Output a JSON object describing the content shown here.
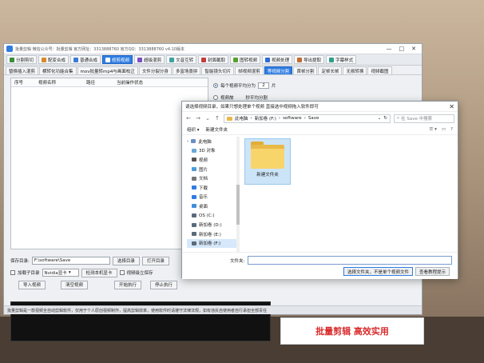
{
  "app": {
    "title": "批量剪辑  微信公众号：批量剪辑  官方网址：3313888760  官方QQ：3313888760  v4.10版本",
    "window_controls": [
      "—",
      "□",
      "✕"
    ]
  },
  "toolbar": {
    "items": [
      {
        "label": "分割剪切",
        "color": "#3a8d3a"
      },
      {
        "label": "配变合成",
        "color": "#d88a2a"
      },
      {
        "label": "普通合成",
        "color": "#3c7ad6"
      },
      {
        "label": "修剪视频",
        "color": "#2f7de1",
        "active": true
      },
      {
        "label": "超级混剪",
        "color": "#7a4fc4"
      },
      {
        "label": "文音互转",
        "color": "#3fa0a0"
      },
      {
        "label": "封面截取",
        "color": "#c43c3c"
      },
      {
        "label": "图转视频",
        "color": "#5a9e2f"
      },
      {
        "label": "视频处理",
        "color": "#2f6ad6"
      },
      {
        "label": "导出提取",
        "color": "#c46a2f"
      },
      {
        "label": "字幕样式",
        "color": "#2f9e8a"
      }
    ]
  },
  "subtabs": {
    "items": [
      {
        "label": "替换插入混剪"
      },
      {
        "label": "横转化功能合集"
      },
      {
        "label": "mov批量转mp4与画面校正"
      },
      {
        "label": "文件分裂分身"
      },
      {
        "label": "多富场景拼"
      },
      {
        "label": "智能镜头切片"
      },
      {
        "label": "帧视频混剪"
      },
      {
        "label": "等视频分割",
        "active": true
      },
      {
        "label": "首帧分割"
      },
      {
        "label": "定帧长帧"
      },
      {
        "label": "无损转换"
      },
      {
        "label": "视频截图"
      }
    ]
  },
  "table": {
    "columns": [
      "序号",
      "视频名称",
      "路径",
      "当前操作状态"
    ]
  },
  "right_panel": {
    "option_split_prefix": "每个视频平均分为",
    "option_split_value": "2",
    "option_split_suffix": "片",
    "option_random": "视频故",
    "option_random_tail": "秒平均分割"
  },
  "controls": {
    "save_dir_label": "保存目录:",
    "save_dir_value": "F:\\software\\Save",
    "choose_dir_btn": "选择目录",
    "open_dir_btn": "打开目录",
    "add_subdir_label": "加载子目录",
    "gpu_select": "Nvidia显卡",
    "detect_gpu_btn": "检测本机显卡",
    "keep_video_label": "视频级立保存",
    "import_btn": "导入视频",
    "clear_btn": "清空视频",
    "start_btn": "开始执行",
    "stop_btn": "停止执行"
  },
  "banner": {
    "text": "批量剪辑 高效实用"
  },
  "statusbar": {
    "text": "批量剪辑是一款视频全自动剪辑软件，仅用于个人原创视频制作，提高剪辑效率，使用软件时请遵守法律法规，如有违反自使用者自行承担全部责任"
  },
  "dialog": {
    "title": "请选择视频目录，如果只想处理单个视频  直接选中视频拖入软件即可",
    "close": "✕",
    "address_parts": [
      "此电脑",
      "新加卷 (F:)",
      "software",
      "Save"
    ],
    "search_placeholder": "在 Save 中搜索",
    "organize": "组织 ▾",
    "new_folder": "新建文件夹",
    "nav_items": [
      {
        "label": "此电脑",
        "icon": "pc-icon",
        "color": "#6a8fc4"
      },
      {
        "label": "3D 对象",
        "icon": "cube-icon",
        "color": "#6aa8d8"
      },
      {
        "label": "视频",
        "icon": "video-icon",
        "color": "#555"
      },
      {
        "label": "图片",
        "icon": "picture-icon",
        "color": "#4a9ed8"
      },
      {
        "label": "文档",
        "icon": "document-icon",
        "color": "#777"
      },
      {
        "label": "下载",
        "icon": "download-icon",
        "color": "#2f7de1"
      },
      {
        "label": "音乐",
        "icon": "music-icon",
        "color": "#2f7de1"
      },
      {
        "label": "桌面",
        "icon": "desktop-icon",
        "color": "#3f8fd8"
      },
      {
        "label": "OS (C:)",
        "icon": "drive-icon",
        "color": "#5a6a7a"
      },
      {
        "label": "新加卷 (D:)",
        "icon": "drive-icon",
        "color": "#5a6a7a"
      },
      {
        "label": "新加卷 (E:)",
        "icon": "drive-icon",
        "color": "#5a6a7a"
      },
      {
        "label": "新加卷 (F:)",
        "icon": "drive-icon",
        "color": "#5a6a7a",
        "selected": true
      }
    ],
    "folder_label": "新建文件夹",
    "filename_label": "文件夹:",
    "select_btn": "选择文件夹，不是单个视频文件",
    "cancel_btn": "查看教程提示"
  }
}
